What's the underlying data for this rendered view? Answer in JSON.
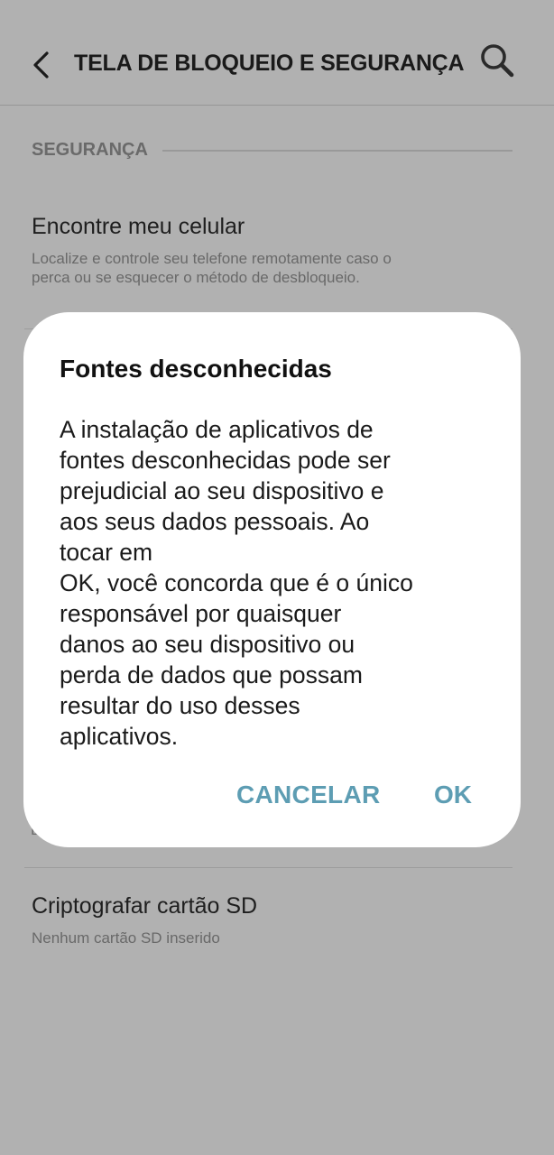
{
  "header": {
    "title": "TELA DE BLOQUEIO E SEGURANÇA"
  },
  "section": {
    "title": "SEGURANÇA"
  },
  "items": [
    {
      "title": "Encontre meu celular",
      "subtitle": "Localize e controle seu telefone remotamente caso o perca ou se esquecer o método de desbloqueio."
    },
    {
      "title": "Criptografar cartão SD",
      "subtitle": "Nenhum cartão SD inserido"
    }
  ],
  "obscured_letter": "D",
  "dialog": {
    "title": "Fontes desconhecidas",
    "body": "A instalação de aplicativos de\nfontes desconhecidas pode ser\nprejudicial ao seu dispositivo e\naos seus dados pessoais. Ao\ntocar em\nOK, você concorda que é o único\nresponsável por quaisquer\ndanos ao seu dispositivo ou\nperda de dados que possam\nresultar do uso desses\naplicativos.",
    "cancel_label": "CANCELAR",
    "ok_label": "OK"
  },
  "icons": {
    "back": "chevron-left-icon",
    "search": "search-icon"
  },
  "colors": {
    "scrim_background": "#b1b1b1",
    "dialog_button": "#5d9db3"
  }
}
